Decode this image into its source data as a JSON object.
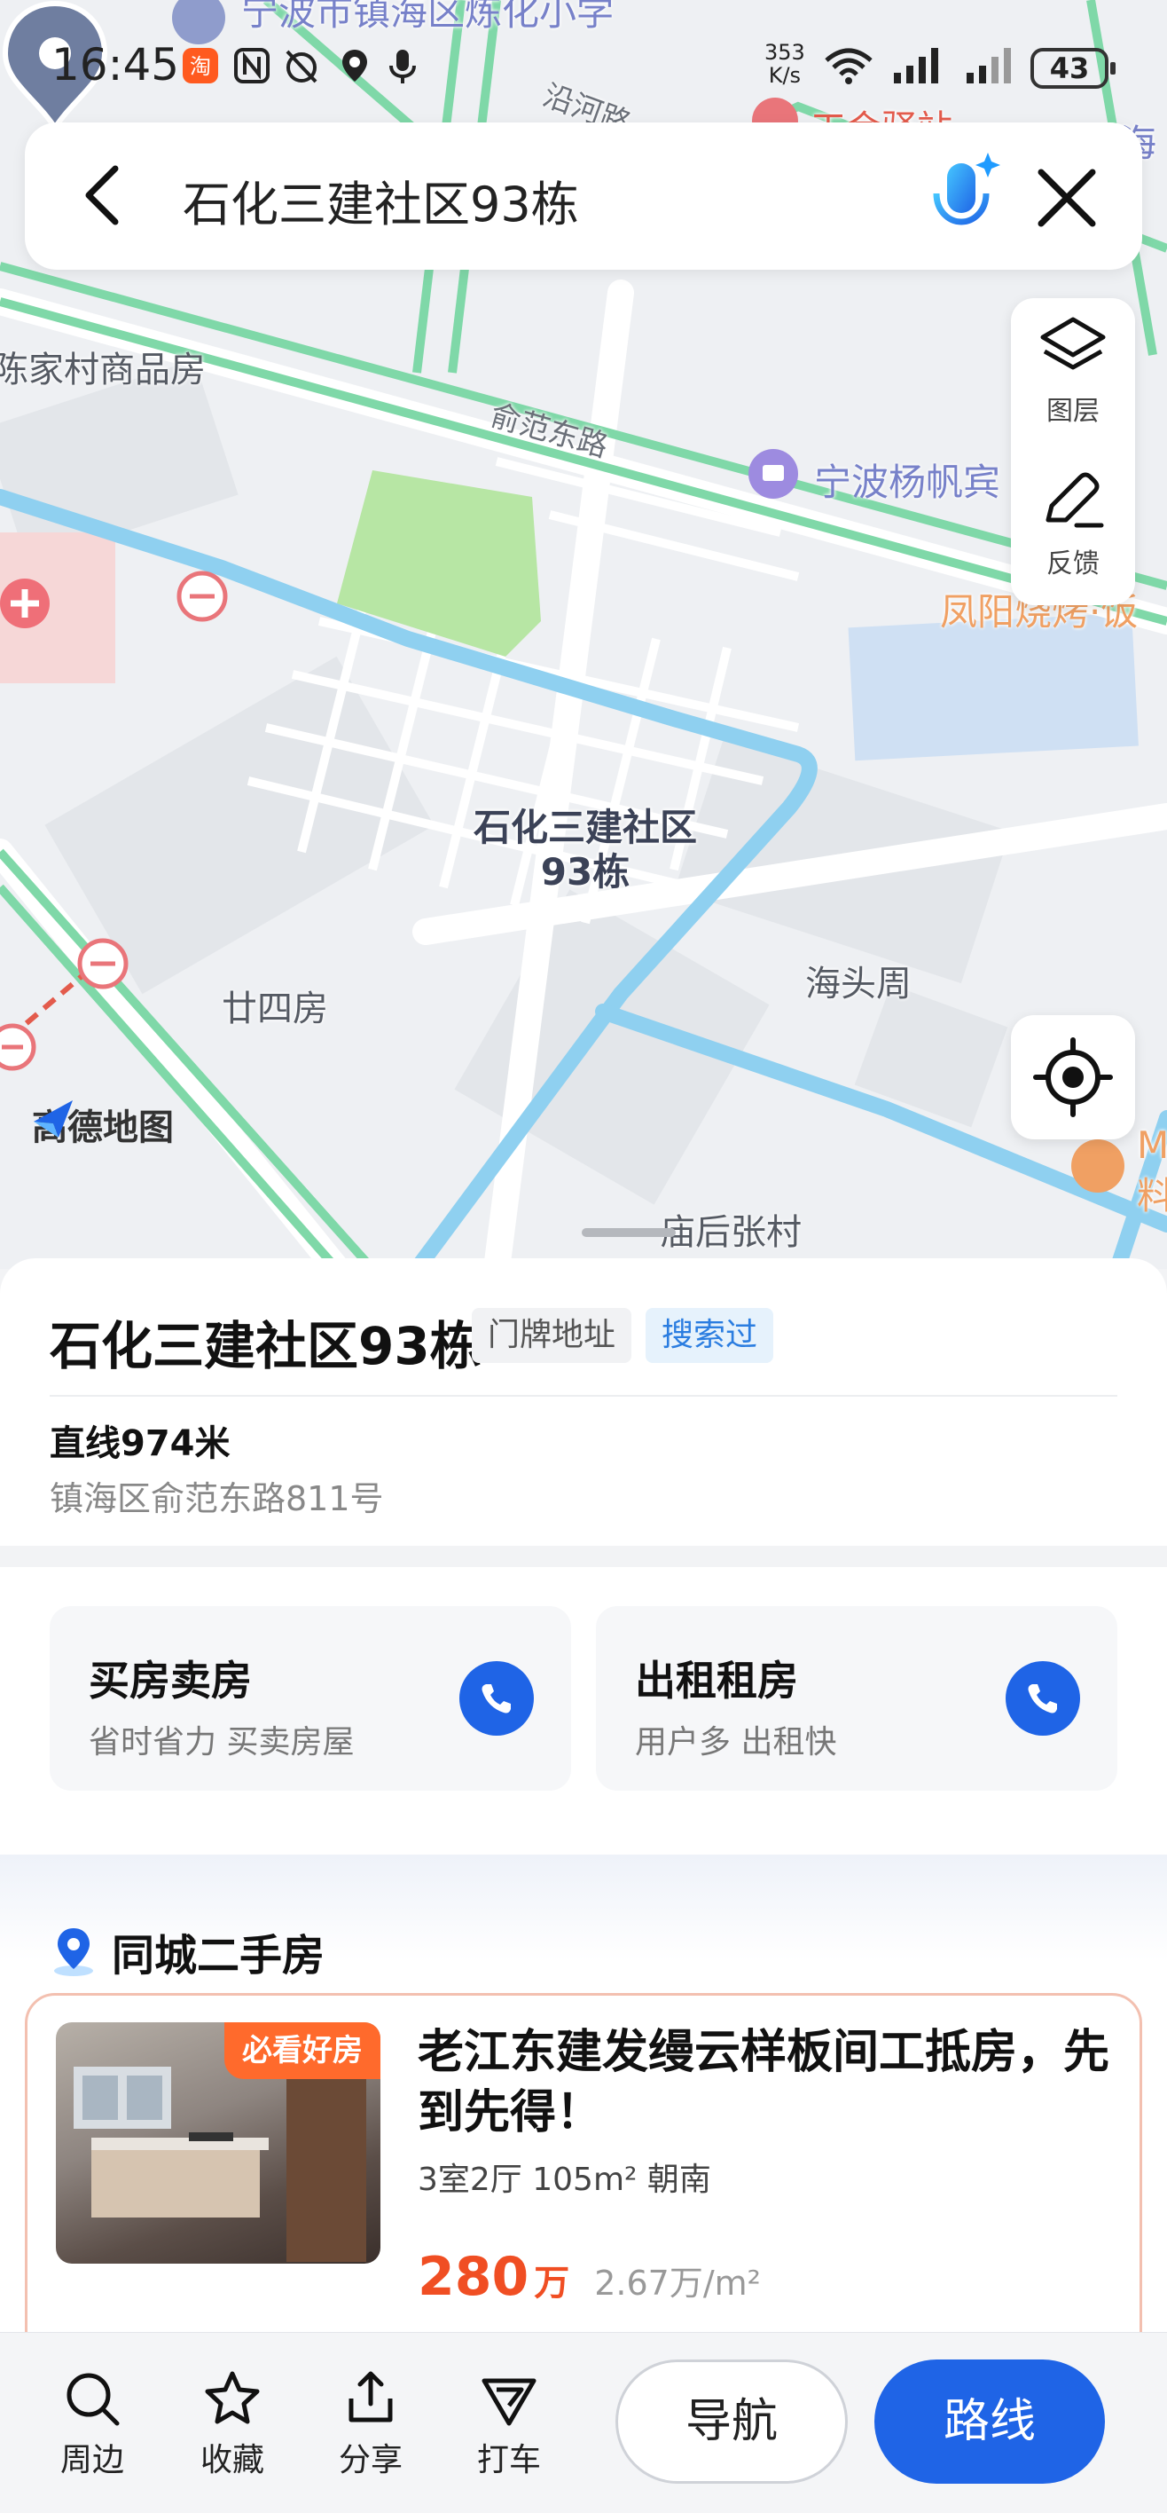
{
  "status_bar": {
    "time": "16:45",
    "net_speed_value": "353",
    "net_speed_unit": "K/s",
    "battery": "43"
  },
  "search": {
    "query": "石化三建社区93栋"
  },
  "map": {
    "labels": {
      "school": "宁波市镇海区炼化小学",
      "road_yanhe": "沿河路",
      "union_station": "工会驿站",
      "hai": "海",
      "chenjiacun": "陈家村商品房",
      "yufan_road": "俞范东路",
      "hotel": "宁波杨帆宾",
      "bbq": "凤阳烧烤·饭",
      "niansifang": "廿四房",
      "haitouzhou": "海头周",
      "miaohouzhangcun": "庙后张村",
      "m_label": "M",
      "liao_label": "料"
    },
    "pin_label": "石化三建社区93栋",
    "logo": "高德地图",
    "tools": {
      "layers": "图层",
      "feedback": "反馈"
    }
  },
  "place": {
    "title": "石化三建社区93栋",
    "tag_type": "门牌地址",
    "tag_searched": "搜索过",
    "distance": "直线974米",
    "address": "镇海区俞范东路811号"
  },
  "services": [
    {
      "title": "买房卖房",
      "subtitle": "省时省力 买卖房屋"
    },
    {
      "title": "出租租房",
      "subtitle": "用户多 出租快"
    }
  ],
  "listings": {
    "section_title": "同城二手房",
    "item": {
      "badge": "必看好房",
      "title": "老江东建发缦云样板间工抵房，先到先得！",
      "spec": "3室2厅 105m² 朝南",
      "price": "280",
      "price_unit": "万",
      "price_per": "2.67万/m²"
    }
  },
  "bottom_bar": {
    "nearby": "周边",
    "favorite": "收藏",
    "share": "分享",
    "taxi": "打车",
    "navigate": "导航",
    "route": "路线"
  },
  "colors": {
    "accent_blue": "#1f64e6",
    "price_red": "#f04e23",
    "badge_orange": "#ff6a2c",
    "map_water": "#8fd0f0",
    "map_road_green": "#7fd8a8",
    "map_park": "#b7e6a4"
  }
}
